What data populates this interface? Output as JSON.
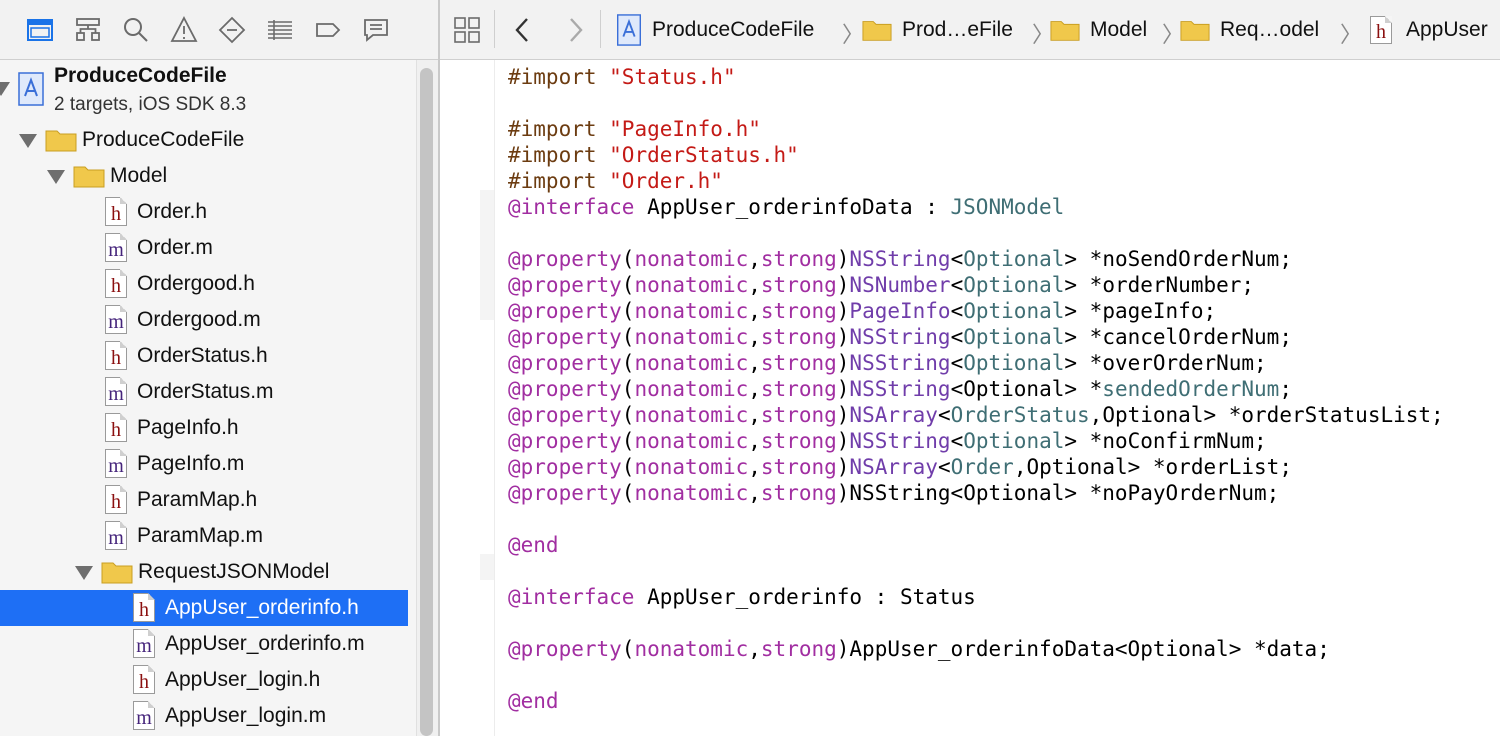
{
  "navigator": {
    "toolbar_icons": [
      "project-navigator-icon",
      "symbol-navigator-icon",
      "find-navigator-icon",
      "issue-navigator-icon",
      "test-navigator-icon",
      "debug-navigator-icon",
      "breakpoint-navigator-icon",
      "report-navigator-icon"
    ],
    "project": {
      "name": "ProduceCodeFile",
      "subtitle": "2 targets, iOS SDK 8.3"
    },
    "groups": {
      "root": "ProduceCodeFile",
      "model": "Model",
      "request": "RequestJSONModel"
    },
    "model_files": [
      {
        "name": "Order.h",
        "kind": "h"
      },
      {
        "name": "Order.m",
        "kind": "m"
      },
      {
        "name": "Ordergood.h",
        "kind": "h"
      },
      {
        "name": "Ordergood.m",
        "kind": "m"
      },
      {
        "name": "OrderStatus.h",
        "kind": "h"
      },
      {
        "name": "OrderStatus.m",
        "kind": "m"
      },
      {
        "name": "PageInfo.h",
        "kind": "h"
      },
      {
        "name": "PageInfo.m",
        "kind": "m"
      },
      {
        "name": "ParamMap.h",
        "kind": "h"
      },
      {
        "name": "ParamMap.m",
        "kind": "m"
      }
    ],
    "request_files": [
      {
        "name": "AppUser_orderinfo.h",
        "kind": "h",
        "selected": true
      },
      {
        "name": "AppUser_orderinfo.m",
        "kind": "m"
      },
      {
        "name": "AppUser_login.h",
        "kind": "h"
      },
      {
        "name": "AppUser_login.m",
        "kind": "m"
      }
    ],
    "file_letters": {
      "h": "h",
      "m": "m"
    },
    "selection_color": "#1e6ff5"
  },
  "jumpbar": {
    "crumbs": [
      "ProduceCodeFile",
      "Prod…eFile",
      "Model",
      "Req…odel",
      "AppUser"
    ],
    "separator": "〉"
  },
  "code_lines": [
    [
      [
        "pp",
        "#import "
      ],
      [
        "str",
        "\"Status.h\""
      ]
    ],
    [],
    [
      [
        "pp",
        "#import "
      ],
      [
        "str",
        "\"PageInfo.h\""
      ]
    ],
    [
      [
        "pp",
        "#import "
      ],
      [
        "str",
        "\"OrderStatus.h\""
      ]
    ],
    [
      [
        "pp",
        "#import "
      ],
      [
        "str",
        "\"Order.h\""
      ]
    ],
    [
      [
        "kw",
        "@interface"
      ],
      [
        "tx",
        " AppUser_orderinfoData : "
      ],
      [
        "cls",
        "JSONModel"
      ]
    ],
    [],
    [
      [
        "kw",
        "@property"
      ],
      [
        "tx",
        "("
      ],
      [
        "kw",
        "nonatomic"
      ],
      [
        "tx",
        ","
      ],
      [
        "kw",
        "strong"
      ],
      [
        "tx",
        ")"
      ],
      [
        "ty",
        "NSString"
      ],
      [
        "tx",
        "<"
      ],
      [
        "cls",
        "Optional"
      ],
      [
        "tx",
        "> *noSendOrderNum;"
      ]
    ],
    [
      [
        "kw",
        "@property"
      ],
      [
        "tx",
        "("
      ],
      [
        "kw",
        "nonatomic"
      ],
      [
        "tx",
        ","
      ],
      [
        "kw",
        "strong"
      ],
      [
        "tx",
        ")"
      ],
      [
        "ty",
        "NSNumber"
      ],
      [
        "tx",
        "<"
      ],
      [
        "cls",
        "Optional"
      ],
      [
        "tx",
        "> *orderNumber;"
      ]
    ],
    [
      [
        "kw",
        "@property"
      ],
      [
        "tx",
        "("
      ],
      [
        "kw",
        "nonatomic"
      ],
      [
        "tx",
        ","
      ],
      [
        "kw",
        "strong"
      ],
      [
        "tx",
        ")"
      ],
      [
        "ty",
        "PageInfo"
      ],
      [
        "tx",
        "<"
      ],
      [
        "cls",
        "Optional"
      ],
      [
        "tx",
        "> *pageInfo;"
      ]
    ],
    [
      [
        "kw",
        "@property"
      ],
      [
        "tx",
        "("
      ],
      [
        "kw",
        "nonatomic"
      ],
      [
        "tx",
        ","
      ],
      [
        "kw",
        "strong"
      ],
      [
        "tx",
        ")"
      ],
      [
        "ty",
        "NSString"
      ],
      [
        "tx",
        "<"
      ],
      [
        "cls",
        "Optional"
      ],
      [
        "tx",
        "> *cancelOrderNum;"
      ]
    ],
    [
      [
        "kw",
        "@property"
      ],
      [
        "tx",
        "("
      ],
      [
        "kw",
        "nonatomic"
      ],
      [
        "tx",
        ","
      ],
      [
        "kw",
        "strong"
      ],
      [
        "tx",
        ")"
      ],
      [
        "ty",
        "NSString"
      ],
      [
        "tx",
        "<"
      ],
      [
        "cls",
        "Optional"
      ],
      [
        "tx",
        "> *overOrderNum;"
      ]
    ],
    [
      [
        "kw",
        "@property"
      ],
      [
        "tx",
        "("
      ],
      [
        "kw",
        "nonatomic"
      ],
      [
        "tx",
        ","
      ],
      [
        "kw",
        "strong"
      ],
      [
        "tx",
        ")"
      ],
      [
        "ty",
        "NSString"
      ],
      [
        "tx",
        "<Optional> *"
      ],
      [
        "cls",
        "sendedOrderNum"
      ],
      [
        "tx",
        ";"
      ]
    ],
    [
      [
        "kw",
        "@property"
      ],
      [
        "tx",
        "("
      ],
      [
        "kw",
        "nonatomic"
      ],
      [
        "tx",
        ","
      ],
      [
        "kw",
        "strong"
      ],
      [
        "tx",
        ")"
      ],
      [
        "ty",
        "NSArray"
      ],
      [
        "tx",
        "<"
      ],
      [
        "cls",
        "OrderStatus"
      ],
      [
        "tx",
        ",Optional> *orderStatusList;"
      ]
    ],
    [
      [
        "kw",
        "@property"
      ],
      [
        "tx",
        "("
      ],
      [
        "kw",
        "nonatomic"
      ],
      [
        "tx",
        ","
      ],
      [
        "kw",
        "strong"
      ],
      [
        "tx",
        ")"
      ],
      [
        "ty",
        "NSString"
      ],
      [
        "tx",
        "<"
      ],
      [
        "cls",
        "Optional"
      ],
      [
        "tx",
        "> *noConfirmNum;"
      ]
    ],
    [
      [
        "kw",
        "@property"
      ],
      [
        "tx",
        "("
      ],
      [
        "kw",
        "nonatomic"
      ],
      [
        "tx",
        ","
      ],
      [
        "kw",
        "strong"
      ],
      [
        "tx",
        ")"
      ],
      [
        "ty",
        "NSArray"
      ],
      [
        "tx",
        "<"
      ],
      [
        "cls",
        "Order"
      ],
      [
        "tx",
        ",Optional> *orderList;"
      ]
    ],
    [
      [
        "kw",
        "@property"
      ],
      [
        "tx",
        "("
      ],
      [
        "kw",
        "nonatomic"
      ],
      [
        "tx",
        ","
      ],
      [
        "kw",
        "strong"
      ],
      [
        "tx",
        ")NSString<Optional> *noPayOrderNum;"
      ]
    ],
    [],
    [
      [
        "kw",
        "@end"
      ]
    ],
    [],
    [
      [
        "kw",
        "@interface"
      ],
      [
        "tx",
        " AppUser_orderinfo : Status"
      ]
    ],
    [],
    [
      [
        "kw",
        "@property"
      ],
      [
        "tx",
        "("
      ],
      [
        "kw",
        "nonatomic"
      ],
      [
        "tx",
        ","
      ],
      [
        "kw",
        "strong"
      ],
      [
        "tx",
        ")AppUser_orderinfoData<Optional> *data;"
      ]
    ],
    [],
    [
      [
        "kw",
        "@end"
      ]
    ]
  ]
}
